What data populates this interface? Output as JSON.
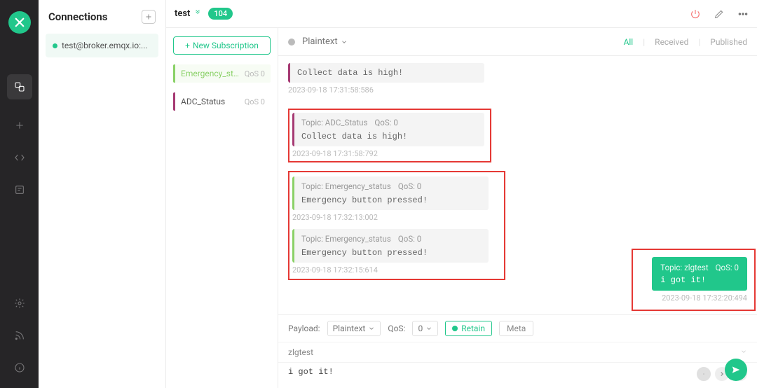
{
  "sidebar": {
    "title": "Connections"
  },
  "connection": {
    "name": "test@broker.emqx.io:..."
  },
  "topbar": {
    "name": "test",
    "badge": "104"
  },
  "subscriptions": {
    "new_btn": "New Subscription",
    "items": [
      {
        "name": "Emergency_status",
        "qos": "QoS 0"
      },
      {
        "name": "ADC_Status",
        "qos": "QoS 0"
      }
    ]
  },
  "msg_header": {
    "format": "Plaintext",
    "filters": {
      "all": "All",
      "received": "Received",
      "published": "Published"
    }
  },
  "messages": {
    "m0": {
      "body": "Collect data is high!",
      "time": "2023-09-18 17:31:58:586"
    },
    "m1": {
      "topic": "Topic: ADC_Status",
      "qos": "QoS: 0",
      "body": "Collect data is high!",
      "time": "2023-09-18 17:31:58:792"
    },
    "m2": {
      "topic": "Topic: Emergency_status",
      "qos": "QoS: 0",
      "body": "Emergency button pressed!",
      "time": "2023-09-18 17:32:13:002"
    },
    "m3": {
      "topic": "Topic: Emergency_status",
      "qos": "QoS: 0",
      "body": "Emergency button pressed!",
      "time": "2023-09-18 17:32:15:614"
    },
    "m4": {
      "topic": "Topic: zlgtest",
      "qos": "QoS: 0",
      "body": "i got it!",
      "time": "2023-09-18 17:32:20:494"
    }
  },
  "composer": {
    "payload_label": "Payload:",
    "payload_format": "Plaintext",
    "qos_label": "QoS:",
    "qos_value": "0",
    "retain": "Retain",
    "meta": "Meta",
    "topic": "zlgtest",
    "payload": "i got it!"
  }
}
